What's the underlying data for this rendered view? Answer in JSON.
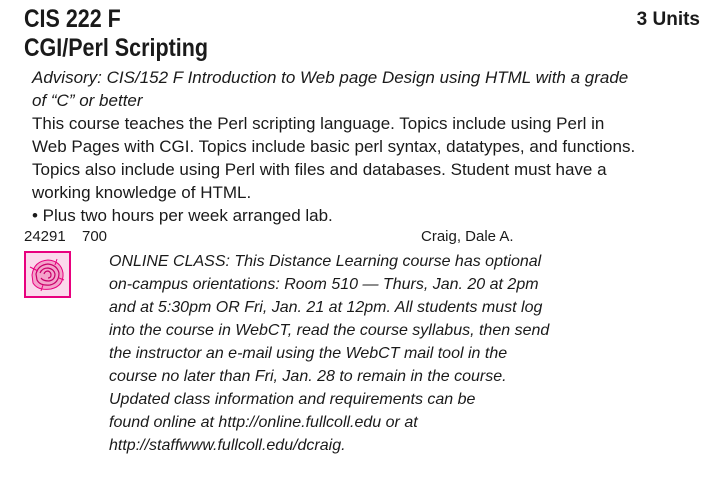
{
  "course": {
    "code": "CIS 222 F",
    "units": "3 Units",
    "title": "CGI/Perl Scripting"
  },
  "advisory": [
    "Advisory: CIS/152 F Introduction to Web page Design using HTML with a grade",
    "of “C” or better"
  ],
  "description": [
    "This course teaches the Perl scripting language. Topics include using Perl in",
    "Web Pages with CGI. Topics include basic perl syntax, datatypes, and functions.",
    "Topics also include using Perl with files and databases. Student must have a",
    "working knowledge of HTML."
  ],
  "lab_note": "• Plus two hours per week arranged lab.",
  "section": {
    "number": "24291",
    "time": "700",
    "instructor": "Craig, Dale A."
  },
  "online_icon": {
    "icon": "online-class-icon",
    "border_color": "#e8007e",
    "fill_color": "#fbd9ec"
  },
  "online_note": [
    "ONLINE CLASS: This Distance Learning course has optional",
    "on-campus orientations: Room 510 — Thurs, Jan. 20 at 2pm",
    "and at 5:30pm OR Fri, Jan. 21 at 12pm. All students must log",
    "into the course in WebCT, read the course syllabus, then send",
    "the instructor an e-mail using the WebCT mail tool in the",
    "course no later than Fri, Jan. 28 to remain in the course.",
    "Updated class information and requirements can be",
    "found online at http://online.fullcoll.edu or at",
    "http://staffwww.fullcoll.edu/dcraig."
  ]
}
